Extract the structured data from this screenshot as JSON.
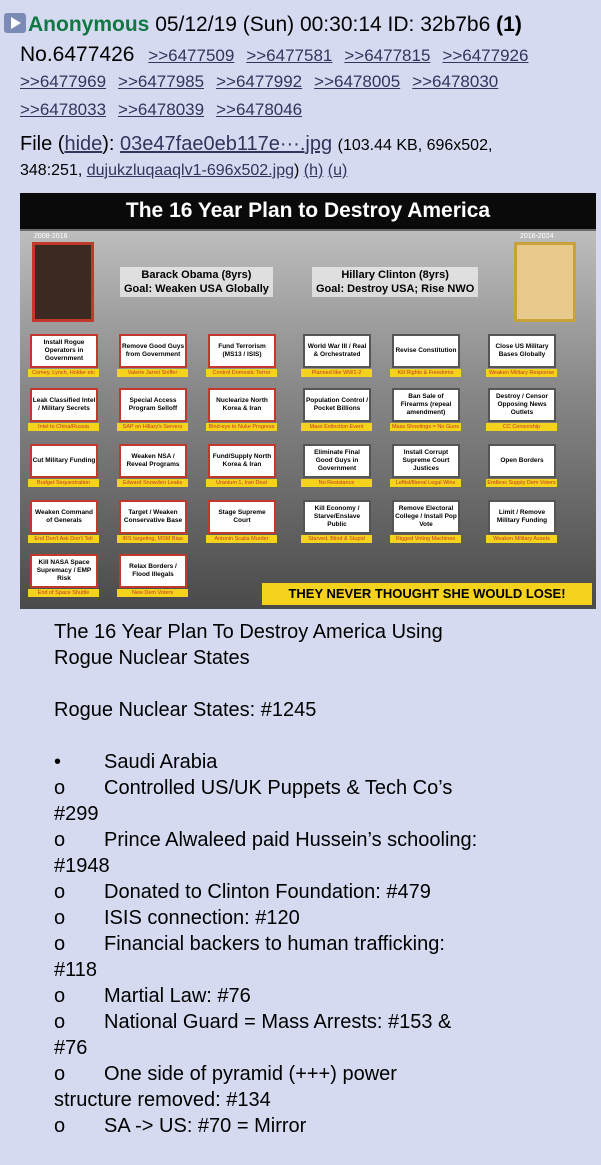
{
  "post": {
    "name": "Anonymous",
    "datetime": "05/12/19 (Sun) 00:30:14",
    "id_label": "ID: 32b7b6",
    "count": "(1)",
    "number": "No.6477426",
    "replies_row1": [
      ">>6477509",
      ">>6477581",
      ">>6477815",
      ">>6477926"
    ],
    "replies_row2": [
      ">>6477969",
      ">>6477985",
      ">>6477992",
      ">>6478005",
      ">>6478030"
    ],
    "replies_row3": [
      ">>6478033",
      ">>6478039",
      ">>6478046"
    ],
    "file_label": "File",
    "hide_link": "hide",
    "file_name": "03e47fae0eb117e···.jpg",
    "file_info": "(103.44 KB, 696x502,",
    "file_info2": "348:251,",
    "orig_name": "dujukzluqaaqlv1-696x502.jpg",
    "h_link": "(h)",
    "u_link": "(u)"
  },
  "image": {
    "title": "The 16 Year Plan to Destroy America",
    "left_years": "2008-2016",
    "right_years": "2016-2024",
    "obama_line1": "Barack Obama (8yrs)",
    "obama_line2": "Goal: Weaken USA Globally",
    "clinton_line1": "Hillary Clinton (8yrs)",
    "clinton_line2": "Goal: Destroy USA; Rise NWO",
    "boxes": [
      {
        "t": "Install Rogue Operators in Government",
        "tag": "Comey, Lynch, Holder etc"
      },
      {
        "t": "Remove Good Guys from Government",
        "tag": "Valerie Jarret Sniffer"
      },
      {
        "t": "Fund Terrorism (MS13 / ISIS)",
        "tag": "Control Domestic Terror"
      },
      {
        "t": "World War III / Real & Orchestrated",
        "tag": "Planned like WW1-2"
      },
      {
        "t": "Revise Constitution",
        "tag": "Kill Rights & Freedoms"
      },
      {
        "t": "Close US Military Bases Globally",
        "tag": "Weaken Military Response"
      },
      {
        "t": "Leak Classified Intel / Military Secrets",
        "tag": "Intel to China/Russia"
      },
      {
        "t": "Special Access Program Selloff",
        "tag": "SAP on Hillary's Servers"
      },
      {
        "t": "Nuclearize North Korea & Iran",
        "tag": "Bind-eye to Nuke Progress"
      },
      {
        "t": "Population Control / Pocket Billions",
        "tag": "Mass Extinction Event"
      },
      {
        "t": "Ban Sale of Firearms (repeal amendment)",
        "tag": "Mass Shootings = No Guns"
      },
      {
        "t": "Destroy / Censor Opposing News Outlets",
        "tag": "CC Censorship"
      },
      {
        "t": "Cut Military Funding",
        "tag": "Budget Sequestration"
      },
      {
        "t": "Weaken NSA / Reveal Programs",
        "tag": "Edward Snowden Leaks"
      },
      {
        "t": "Fund/Supply North Korea & Iran",
        "tag": "Uranium 1, Iran Deal"
      },
      {
        "t": "Eliminate Final Good Guys in Government",
        "tag": "No Resistance"
      },
      {
        "t": "Install Corrupt Supreme Court Justices",
        "tag": "Leftist/liberal Legal Wins"
      },
      {
        "t": "Open Borders",
        "tag": "Endless Supply Dem Voters"
      },
      {
        "t": "Weaken Command of Generals",
        "tag": "End Don't Ask Don't Tell"
      },
      {
        "t": "Target / Weaken Conservative Base",
        "tag": "IRS targeting, MSM Bias"
      },
      {
        "t": "Stage Supreme Court",
        "tag": "Antonin Scalia Murder"
      },
      {
        "t": "Kill Economy / Starve/Enslave Public",
        "tag": "Starved, Blind & Stupid"
      },
      {
        "t": "Remove Electoral College / Install Pop Vote",
        "tag": "Rigged Voting Machines"
      },
      {
        "t": "Limit / Remove Military Funding",
        "tag": "Weaken Military Assets"
      },
      {
        "t": "Kill NASA Space Supremacy / EMP Risk",
        "tag": "End of Space Shuttle"
      },
      {
        "t": "Relax Borders / Flood Illegals",
        "tag": "New Dem Voters"
      }
    ],
    "banner": "THEY NEVER THOUGHT SHE WOULD LOSE!"
  },
  "text": {
    "heading1": "The 16 Year Plan To Destroy America Using",
    "heading2": "Rogue Nuclear States",
    "rogue": "Rogue Nuclear States: #1245",
    "bullet": "•",
    "country": "Saudi Arabia",
    "o": "o",
    "items": [
      {
        "a": "Controlled US/UK Puppets & Tech Co’s",
        "b": "#299"
      },
      {
        "a": "Prince Alwaleed paid Hussein’s schooling:",
        "b": "#1948"
      },
      {
        "a": "Donated to Clinton Foundation: #479",
        "b": ""
      },
      {
        "a": "ISIS connection: #120",
        "b": ""
      },
      {
        "a": "Financial backers to human trafficking:",
        "b": "#118"
      },
      {
        "a": "Martial Law: #76",
        "b": ""
      },
      {
        "a": "National Guard = Mass Arrests: #153 &",
        "b": "#76"
      },
      {
        "a": "One side of pyramid (+++) power",
        "b": "structure removed: #134"
      },
      {
        "a": "SA -> US: #70 = Mirror",
        "b": ""
      }
    ]
  }
}
